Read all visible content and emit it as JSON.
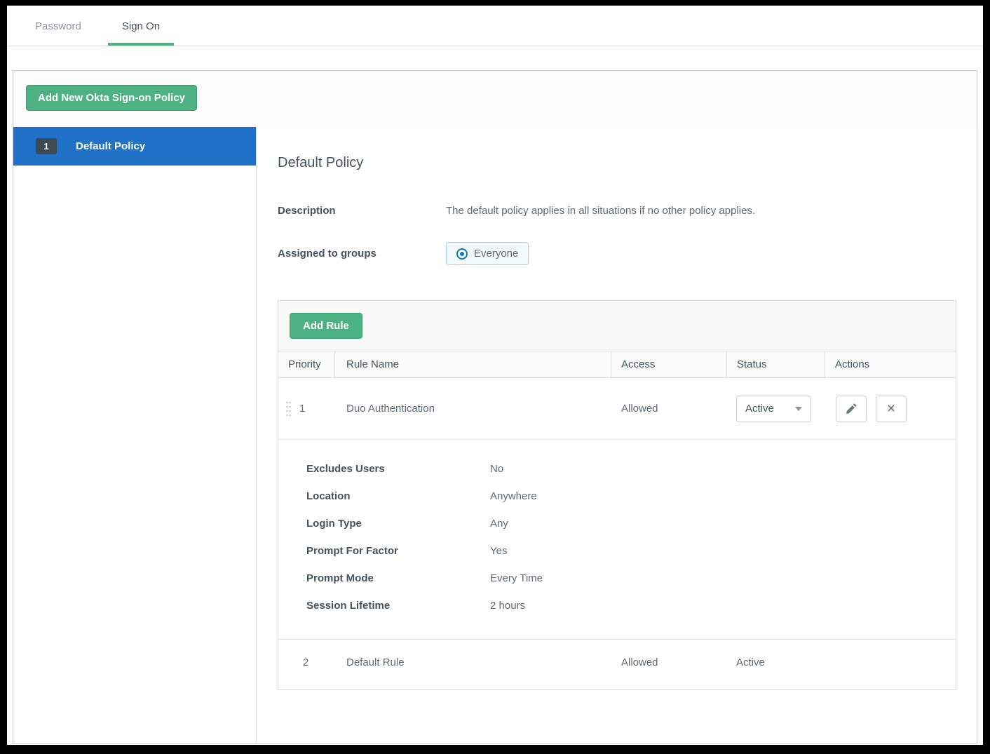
{
  "tabs": [
    {
      "label": "Password",
      "active": false
    },
    {
      "label": "Sign On",
      "active": true
    }
  ],
  "toolbar": {
    "add_policy_label": "Add New Okta Sign-on Policy"
  },
  "policy_list": {
    "items": [
      {
        "priority": "1",
        "label": "Default Policy",
        "selected": true
      }
    ]
  },
  "policy_detail": {
    "title": "Default Policy",
    "description_label": "Description",
    "description_value": "The default policy applies in all situations if no other policy applies.",
    "assigned_label": "Assigned to groups",
    "assigned_group": "Everyone"
  },
  "rules": {
    "add_rule_label": "Add Rule",
    "columns": [
      "Priority",
      "Rule Name",
      "Access",
      "Status",
      "Actions"
    ],
    "rows": [
      {
        "priority": "1",
        "name": "Duo Authentication",
        "access": "Allowed",
        "status": "Active",
        "status_control": "dropdown"
      },
      {
        "priority": "2",
        "name": "Default Rule",
        "access": "Allowed",
        "status": "Active",
        "status_control": "text"
      }
    ],
    "details": [
      {
        "label": "Excludes Users",
        "value": "No"
      },
      {
        "label": "Location",
        "value": "Anywhere"
      },
      {
        "label": "Login Type",
        "value": "Any"
      },
      {
        "label": "Prompt For Factor",
        "value": "Yes"
      },
      {
        "label": "Prompt Mode",
        "value": "Every Time"
      },
      {
        "label": "Session Lifetime",
        "value": "2 hours"
      }
    ]
  },
  "icons": {
    "close": "×"
  },
  "colors": {
    "accent_green": "#4cb183",
    "selected_blue": "#1f72c8",
    "radio_blue": "#0d79ba",
    "chip_bg": "#f2fafd",
    "chip_border": "#a3d4ec"
  }
}
